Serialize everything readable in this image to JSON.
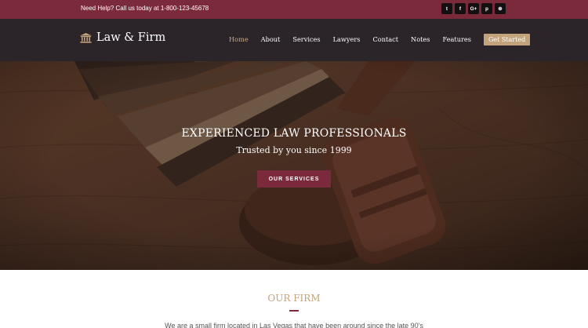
{
  "topbar": {
    "help_text": "Need Help? Call us today at 1-800-123-45678",
    "socials": [
      {
        "icon": "twitter-icon",
        "glyph": "t"
      },
      {
        "icon": "facebook-icon",
        "glyph": "f"
      },
      {
        "icon": "google-plus-icon",
        "glyph": "G+"
      },
      {
        "icon": "pinterest-icon",
        "glyph": "p"
      },
      {
        "icon": "dribbble-icon",
        "glyph": "⊛"
      }
    ]
  },
  "header": {
    "logo_icon": "courthouse-icon",
    "logo_text": "Law & Firm",
    "nav": [
      {
        "label": "Home",
        "active": true
      },
      {
        "label": "About",
        "active": false
      },
      {
        "label": "Services",
        "active": false
      },
      {
        "label": "Lawyers",
        "active": false
      },
      {
        "label": "Contact",
        "active": false
      },
      {
        "label": "Notes",
        "active": false
      },
      {
        "label": "Features",
        "active": false
      }
    ],
    "cta_label": "Get Started"
  },
  "hero": {
    "title": "EXPERIENCED LAW PROFESSIONALS",
    "subtitle": "Trusted by you since 1999",
    "button_label": "OUR SERVICES"
  },
  "firm": {
    "title": "OUR FIRM",
    "text": "We are a small firm located in Las Vegas that have been around since the late 90's"
  },
  "colors": {
    "brand": "#7a2a3b",
    "gold": "#c3a37c",
    "header_bg": "#2b2529"
  }
}
